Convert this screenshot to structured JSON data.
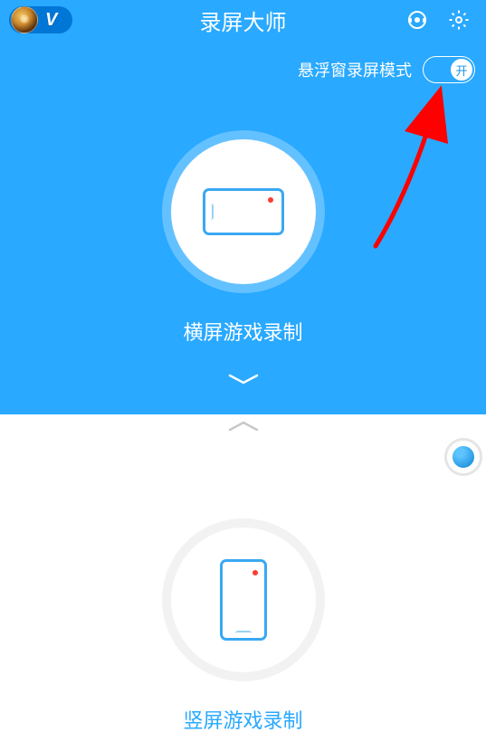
{
  "header": {
    "app_title": "录屏大师",
    "vip_badge": "V"
  },
  "float_mode": {
    "label": "悬浮窗录屏模式",
    "toggle_text": "开",
    "enabled": true
  },
  "modes": {
    "landscape": {
      "label": "横屏游戏录制"
    },
    "portrait": {
      "label": "竖屏游戏录制"
    }
  },
  "colors": {
    "primary": "#29a9ff",
    "arrow": "#ff0000"
  }
}
